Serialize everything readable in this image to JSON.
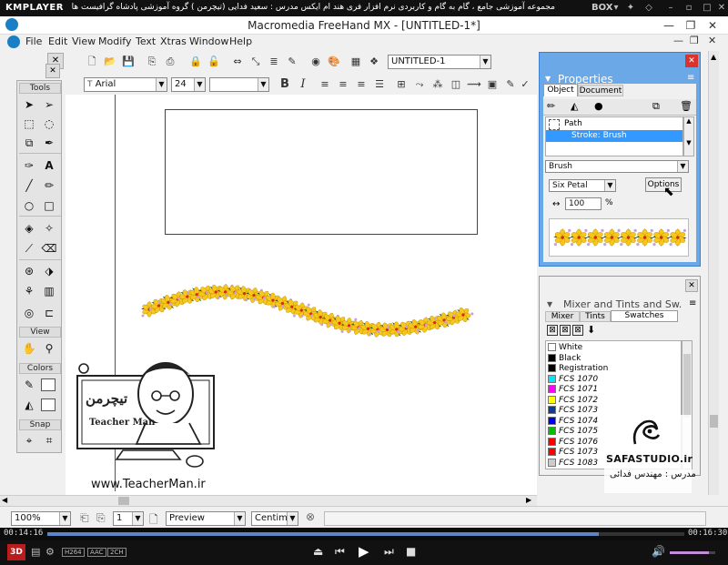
{
  "player": {
    "logo": "KMPLAYER",
    "course_title": "مجموعه آموزشی جامع ، گام به گام و کاربردی نرم افزار فری هند ام ایکس  مدرس : سعید فدایی (تیچرمن ) گروه آموزشی پادشاه گرافیست ها",
    "box_label": "BOX",
    "time_elapsed": "00:14:16",
    "time_total": "00:16:30",
    "codec_badges": [
      "H264",
      "AAC",
      "2CH"
    ],
    "progress": 0.865,
    "volume": 0.85
  },
  "window": {
    "title": "Macromedia FreeHand MX - [UNTITLED-1*]"
  },
  "menu": [
    "File",
    "Edit",
    "View",
    "Modify",
    "Text",
    "Xtras",
    "Window",
    "Help"
  ],
  "toolbar": {
    "document_name": "UNTITLED-1",
    "font_name": "Arial",
    "font_size": "24",
    "font_style": ""
  },
  "tools": {
    "title": "Tools",
    "view_title": "View",
    "colors_title": "Colors",
    "snap_title": "Snap"
  },
  "properties": {
    "title": "Properties",
    "tabs": [
      "Object",
      "Document"
    ],
    "path_label": "Path",
    "stroke_label": "Stroke: Brush",
    "type_value": "Brush",
    "brush_value": "Six Petal",
    "options_label": "Options",
    "width_value": "100",
    "width_unit": "%"
  },
  "swatches": {
    "title": "Mixer and Tints and Sw...",
    "tabs": [
      "Mixer",
      "Tints",
      "Swatches"
    ],
    "items": [
      {
        "name": "White",
        "color": "#ffffff"
      },
      {
        "name": "Black",
        "color": "#000000"
      },
      {
        "name": "Registration",
        "color": "#000000"
      },
      {
        "name": "FCS 1070",
        "color": "#00e5ff"
      },
      {
        "name": "FCS 1071",
        "color": "#ff00ff"
      },
      {
        "name": "FCS 1072",
        "color": "#ffff00"
      },
      {
        "name": "FCS 1073",
        "color": "#0a3d9a"
      },
      {
        "name": "FCS 1074",
        "color": "#0000ff"
      },
      {
        "name": "FCS 1075",
        "color": "#00c000"
      },
      {
        "name": "FCS 1076",
        "color": "#ff0000"
      },
      {
        "name": "FCS 1073",
        "color": "#ff0000"
      },
      {
        "name": "FCS 1083",
        "color": "#cccccc"
      }
    ]
  },
  "watermarks": {
    "teacher_url": "www.TeacherMan.ir",
    "teacher_name": "Teacher Man",
    "safa_studio": "SAFASTUDIO.ir",
    "safa_teacher": "مدرس : مهندس فدائی"
  },
  "status": {
    "zoom": "100%",
    "page": "1",
    "mode": "Preview",
    "units": "Centimeters"
  }
}
